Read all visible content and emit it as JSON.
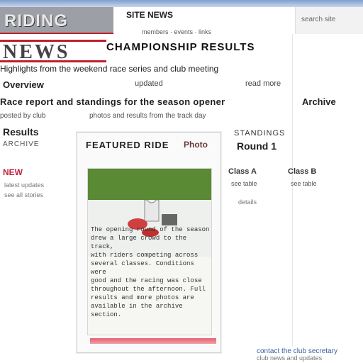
{
  "colors": {
    "accent": "#c0202c",
    "link": "#3a5c9c",
    "banner": "#9d9fa6"
  },
  "header": {
    "banner_text": "RIDING",
    "nav_label": "SITE NEWS",
    "sub_text": "members · events · links",
    "right_label": "search site"
  },
  "hero": {
    "letters": "NEWS"
  },
  "main": {
    "heading": "CHAMPIONSHIP RESULTS",
    "subheading": "Highlights from the weekend race series and club meeting",
    "row1": {
      "left": "Overview",
      "center": "updated",
      "right": "read more"
    },
    "long_line": "Race report and standings for the season opener",
    "side_label": "Archive",
    "small_line": "posted by club",
    "mid_line": "photos and results from the track day"
  },
  "left": {
    "stat": "Results",
    "sub": "ARCHIVE",
    "link": "NEW",
    "meta": "latest updates",
    "foot": "see all stories"
  },
  "card": {
    "title": "FEATURED RIDE",
    "title_right": "Photo",
    "text_lines": [
      "The opening round of the season",
      "drew a large crowd to the track,",
      "with riders competing across",
      "several classes. Conditions were",
      "good and the racing was close",
      "throughout the afternoon. Full",
      "results and more photos are",
      "available in the archive section."
    ]
  },
  "right": {
    "heading": "STANDINGS",
    "value": "Round 1",
    "col1": "Class A",
    "col2": "Class B",
    "sub1": "see table",
    "sub2": "see table",
    "small": "details"
  },
  "footer": {
    "link": "contact the club secretary",
    "text": "club news and updates"
  }
}
